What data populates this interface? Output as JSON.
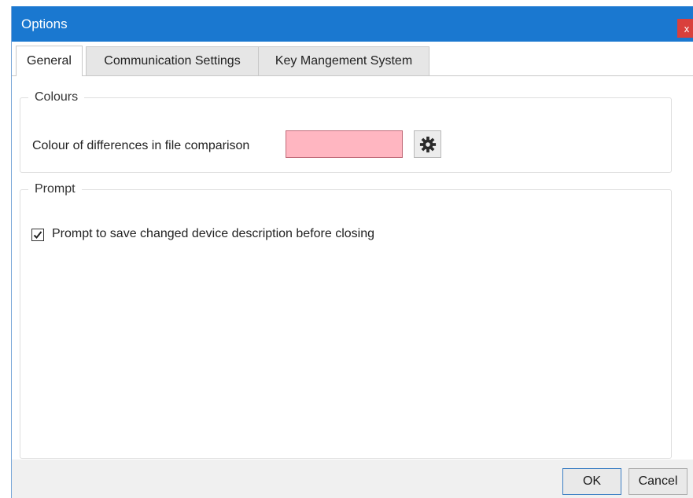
{
  "window": {
    "title": "Options",
    "close_label": "x"
  },
  "tabs": [
    {
      "label": "General",
      "active": true
    },
    {
      "label": "Communication Settings",
      "active": false
    },
    {
      "label": "Key Mangement System",
      "active": false
    }
  ],
  "colours_group": {
    "legend": "Colours",
    "diff_label": "Colour of differences in file comparison",
    "swatch_color": "#ffb6c1",
    "picker_icon": "gear-icon"
  },
  "prompt_group": {
    "legend": "Prompt",
    "checkbox_label": "Prompt to save changed device description before closing",
    "checked": true
  },
  "buttons": {
    "ok": "OK",
    "cancel": "Cancel"
  }
}
